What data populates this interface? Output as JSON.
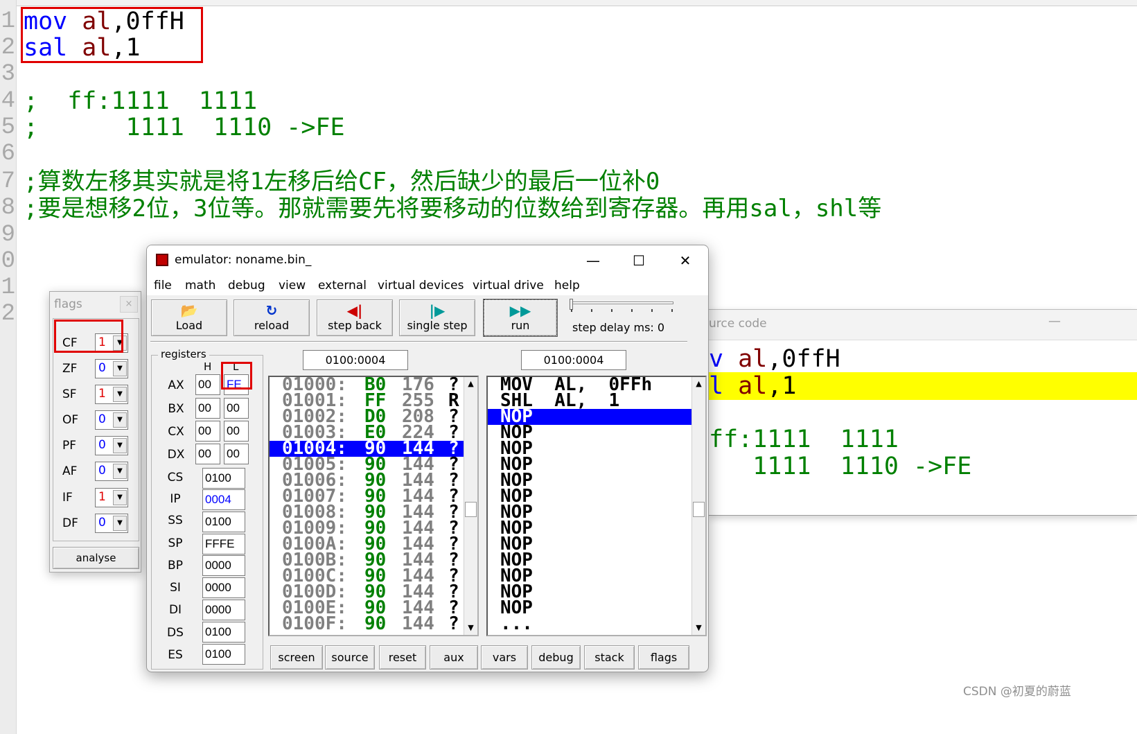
{
  "editor": {
    "line_numbers": [
      "1",
      "2",
      "3",
      "4",
      "5",
      "6",
      "7",
      "8",
      "9",
      "0",
      "1",
      "2"
    ],
    "line1": {
      "kw": "mov",
      "reg": "al",
      "rest": ",0ffH"
    },
    "line2": {
      "kw": "sal",
      "reg": "al",
      "rest": ",1"
    },
    "line4": ";  ff:1111  1111",
    "line5": ";      1111  1110 ->FE",
    "line7": ";算数左移其实就是将1左移后给CF，然后缺少的最后一位补0",
    "line8": ";要是想移2位，3位等。那就需要先将要移动的位数给到寄存器。再用sal，shl等"
  },
  "emulator": {
    "title": "emulator: noname.bin_",
    "window_buttons": {
      "minimize": "—",
      "maximize": "☐",
      "close": "✕"
    },
    "menu": [
      "file",
      "math",
      "debug",
      "view",
      "external",
      "virtual devices",
      "virtual drive",
      "help"
    ],
    "toolbar": {
      "load": "Load",
      "reload": "reload",
      "step_back": "step back",
      "single_step": "single step",
      "run": "run"
    },
    "step_delay_label": "step delay ms: 0",
    "registers": {
      "title": "registers",
      "col_h": "H",
      "col_l": "L",
      "gp": [
        {
          "name": "AX",
          "h": "00",
          "l": "FE"
        },
        {
          "name": "BX",
          "h": "00",
          "l": "00"
        },
        {
          "name": "CX",
          "h": "00",
          "l": "00"
        },
        {
          "name": "DX",
          "h": "00",
          "l": "00"
        }
      ],
      "seg": [
        {
          "name": "CS",
          "val": "0100"
        },
        {
          "name": "IP",
          "val": "0004"
        },
        {
          "name": "SS",
          "val": "0100"
        },
        {
          "name": "SP",
          "val": "FFFE"
        },
        {
          "name": "BP",
          "val": "0000"
        },
        {
          "name": "SI",
          "val": "0000"
        },
        {
          "name": "DI",
          "val": "0000"
        },
        {
          "name": "DS",
          "val": "0100"
        },
        {
          "name": "ES",
          "val": "0100"
        }
      ]
    },
    "mem_address": "0100:0004",
    "dis_address": "0100:0004",
    "memory": [
      {
        "addr": "01000:",
        "hex": "B0",
        "dec": "176",
        "chr": "?"
      },
      {
        "addr": "01001:",
        "hex": "FF",
        "dec": "255",
        "chr": "R"
      },
      {
        "addr": "01002:",
        "hex": "D0",
        "dec": "208",
        "chr": "?"
      },
      {
        "addr": "01003:",
        "hex": "E0",
        "dec": "224",
        "chr": "?"
      },
      {
        "addr": "01004:",
        "hex": "90",
        "dec": "144",
        "chr": "?"
      },
      {
        "addr": "01005:",
        "hex": "90",
        "dec": "144",
        "chr": "?"
      },
      {
        "addr": "01006:",
        "hex": "90",
        "dec": "144",
        "chr": "?"
      },
      {
        "addr": "01007:",
        "hex": "90",
        "dec": "144",
        "chr": "?"
      },
      {
        "addr": "01008:",
        "hex": "90",
        "dec": "144",
        "chr": "?"
      },
      {
        "addr": "01009:",
        "hex": "90",
        "dec": "144",
        "chr": "?"
      },
      {
        "addr": "0100A:",
        "hex": "90",
        "dec": "144",
        "chr": "?"
      },
      {
        "addr": "0100B:",
        "hex": "90",
        "dec": "144",
        "chr": "?"
      },
      {
        "addr": "0100C:",
        "hex": "90",
        "dec": "144",
        "chr": "?"
      },
      {
        "addr": "0100D:",
        "hex": "90",
        "dec": "144",
        "chr": "?"
      },
      {
        "addr": "0100E:",
        "hex": "90",
        "dec": "144",
        "chr": "?"
      },
      {
        "addr": "0100F:",
        "hex": "90",
        "dec": "144",
        "chr": "?"
      }
    ],
    "disasm": [
      "MOV  AL,  0FFh",
      "SHL  AL,  1",
      "NOP",
      "NOP",
      "NOP",
      "NOP",
      "NOP",
      "NOP",
      "NOP",
      "NOP",
      "NOP",
      "NOP",
      "NOP",
      "NOP",
      "NOP",
      "..."
    ],
    "bottom_buttons": [
      "screen",
      "source",
      "reset",
      "aux",
      "vars",
      "debug",
      "stack",
      "flags"
    ]
  },
  "flags": {
    "title": "flags",
    "close": "×",
    "items": [
      {
        "name": "CF",
        "val": "1"
      },
      {
        "name": "ZF",
        "val": "0"
      },
      {
        "name": "SF",
        "val": "1"
      },
      {
        "name": "OF",
        "val": "0"
      },
      {
        "name": "PF",
        "val": "0"
      },
      {
        "name": "AF",
        "val": "0"
      },
      {
        "name": "IF",
        "val": "1"
      },
      {
        "name": "DF",
        "val": "0"
      }
    ],
    "analyse": "analyse"
  },
  "source_window": {
    "title": "urce code",
    "minimize": "—",
    "line1": {
      "kw": "v",
      "reg": "al",
      "rest": ",0ffH"
    },
    "line2": {
      "kw": "l",
      "reg": "al",
      "rest": ",1"
    },
    "line4": "ff:1111  1111",
    "line5": "   1111  1110 ->FE"
  },
  "watermark": "CSDN @初夏的蔚蓝",
  "colors": {
    "keyword": "#0000ff",
    "register": "#800000",
    "comment": "#008000",
    "selection": "#0000ff",
    "highlight": "#ffff00",
    "annotation": "#e00000"
  }
}
